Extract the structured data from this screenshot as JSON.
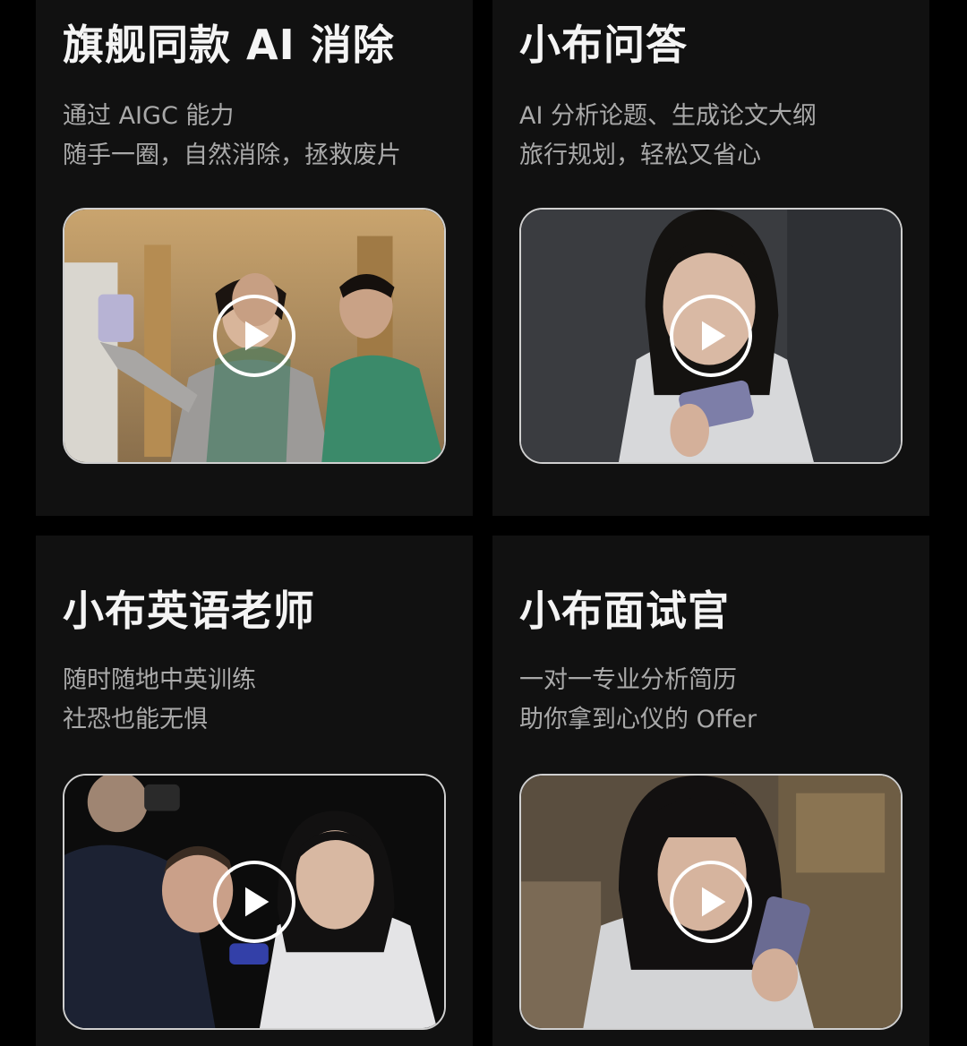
{
  "cards": [
    {
      "title": "旗舰同款 AI 消除",
      "desc": [
        "通过 AIGC 能力",
        "随手一圈，自然消除，拯救废片"
      ]
    },
    {
      "title": "小布问答",
      "desc": [
        "AI 分析论题、生成论文大纲",
        "旅行规划，轻松又省心"
      ]
    },
    {
      "title": "小布英语老师",
      "desc": [
        "随时随地中英训练",
        "社恐也能无惧"
      ]
    },
    {
      "title": "小布面试官",
      "desc": [
        "一对一专业分析简历",
        "助你拿到心仪的 Offer"
      ]
    }
  ],
  "icons": {
    "play": "play-icon"
  },
  "colors": {
    "background": "#000000",
    "card": "#111111",
    "title": "#f4f4f4",
    "desc": "#a9a9a9",
    "border": "#cfcfcf"
  }
}
